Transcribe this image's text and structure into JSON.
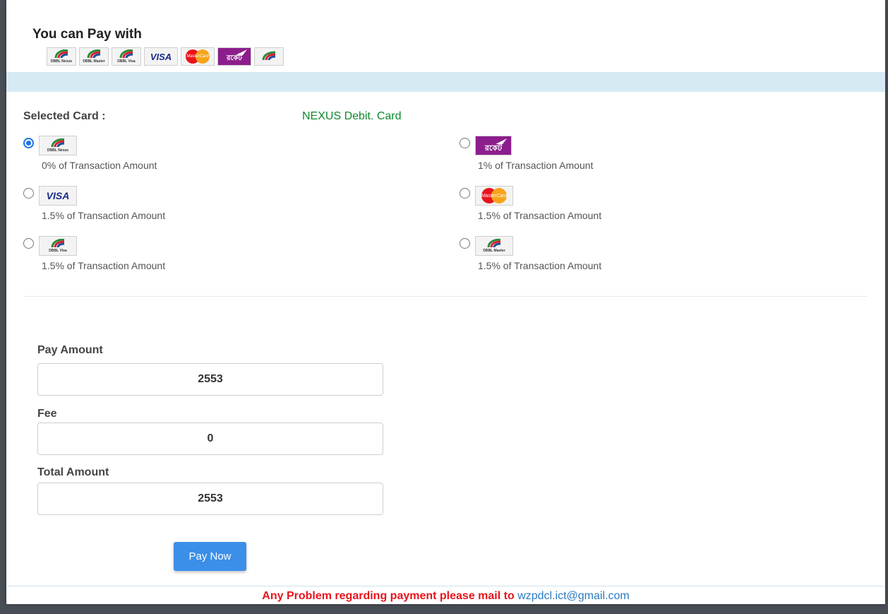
{
  "header": {
    "title": "You can Pay with",
    "logos": [
      {
        "name": "DBBL Nexus",
        "caption": "DBBL Nexus"
      },
      {
        "name": "DBBL Master",
        "caption": "DBBL Master"
      },
      {
        "name": "DBBL Visa",
        "caption": "DBBL Visa"
      },
      {
        "name": "VISA",
        "caption": "VISA"
      },
      {
        "name": "MasterCard",
        "caption": "MasterCard"
      },
      {
        "name": "Rocket",
        "caption": "রকেট"
      },
      {
        "name": "DBBL",
        "caption": ""
      }
    ]
  },
  "selection": {
    "label": "Selected Card :",
    "value": "NEXUS Debit. Card"
  },
  "options": [
    {
      "id": "nexus",
      "logo_caption": "DBBL Nexus",
      "fee": "0% of Transaction Amount",
      "checked": true
    },
    {
      "id": "rocket",
      "logo_caption": "রকেট",
      "fee": "1% of Transaction Amount",
      "checked": false
    },
    {
      "id": "visa",
      "logo_caption": "VISA",
      "fee": "1.5% of Transaction Amount",
      "checked": false
    },
    {
      "id": "mastercard",
      "logo_caption": "MasterCard",
      "fee": "1.5% of Transaction Amount",
      "checked": false
    },
    {
      "id": "dbbl-visa",
      "logo_caption": "DBBL Visa",
      "fee": "1.5% of Transaction Amount",
      "checked": false
    },
    {
      "id": "dbbl-master",
      "logo_caption": "DBBL Master",
      "fee": "1.5% of Transaction Amount",
      "checked": false
    }
  ],
  "form": {
    "pay_amount_label": "Pay Amount",
    "pay_amount_value": "2553",
    "fee_label": "Fee",
    "fee_value": "0",
    "total_label": "Total Amount",
    "total_value": "2553",
    "pay_button": "Pay Now"
  },
  "footer": {
    "message": "Any Problem regarding payment please mail to",
    "email": "wzpdcl.ict@gmail.com"
  },
  "colors": {
    "accent": "#3b8fe8",
    "selected_value": "#0b8a2c",
    "warning": "#e8141c",
    "link": "#2b7bc0",
    "band": "#d6eaf4"
  }
}
